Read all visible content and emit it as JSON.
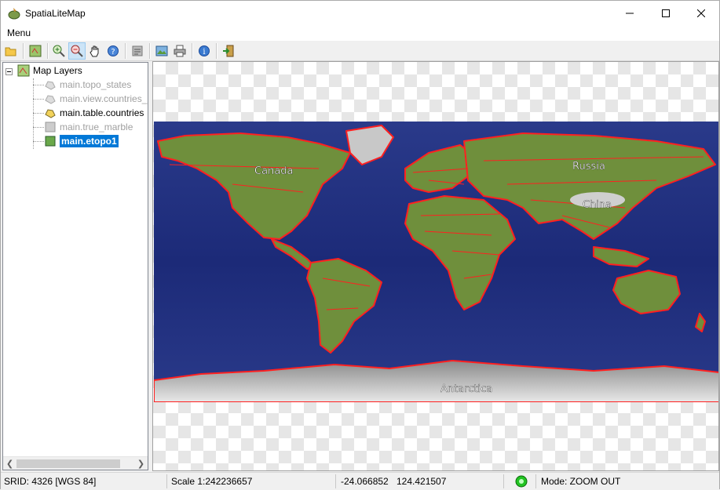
{
  "window": {
    "title": "SpatiaLiteMap"
  },
  "menubar": {
    "menu_label": "Menu"
  },
  "toolbar": {
    "buttons": [
      "open-icon",
      "layer-config-icon",
      "zoom-in-icon",
      "zoom-out-icon",
      "pan-icon",
      "identify-icon",
      "sql-icon",
      "export-image-icon",
      "print-icon",
      "about-icon",
      "exit-icon"
    ],
    "active": "zoom-out-icon"
  },
  "tree": {
    "root_label": "Map Layers",
    "layers": [
      {
        "label": "main.topo_states",
        "state": "disabled"
      },
      {
        "label": "main.view.countries_",
        "state": "disabled"
      },
      {
        "label": "main.table.countries",
        "state": "enabled"
      },
      {
        "label": "main.true_marble",
        "state": "disabled"
      },
      {
        "label": "main.etopo1",
        "state": "selected"
      }
    ]
  },
  "map": {
    "labels": [
      "Canada",
      "Russia",
      "China",
      "Antarctica"
    ],
    "colors": {
      "ocean": "#1c2a78",
      "land": "#6f8f3c",
      "borders": "#ff2020",
      "ice": "#c8c8c8"
    }
  },
  "statusbar": {
    "srid": "SRID: 4326 [WGS 84]",
    "scale": "Scale 1:242236657",
    "coord_x": "-24.066852",
    "coord_y": "124.421507",
    "mode": "Mode: ZOOM OUT",
    "status_color": "#22c322"
  }
}
